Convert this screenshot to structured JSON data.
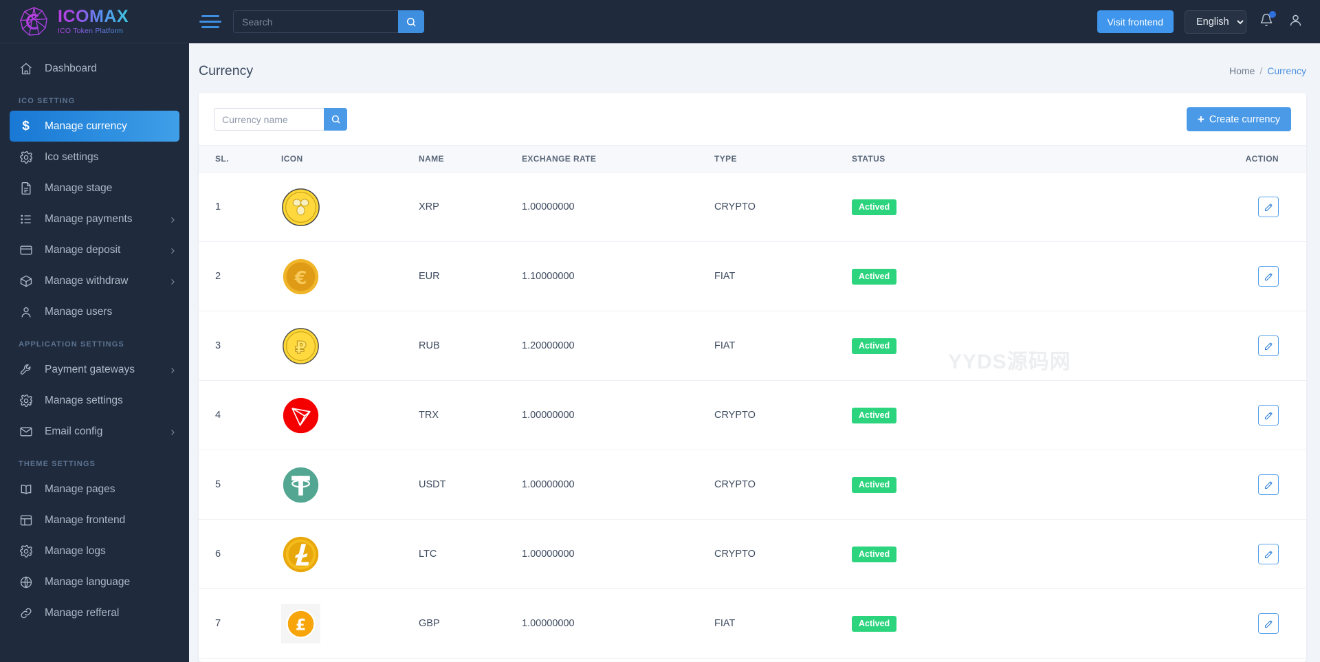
{
  "brand": {
    "title": "ICOMAX",
    "subtitle": "ICO Token Platform",
    "logo_icon": "icomax-gem-logo"
  },
  "topbar": {
    "menu_toggle_icon": "hamburger-icon",
    "search": {
      "placeholder": "Search",
      "value": "",
      "icon": "search-icon"
    },
    "visit_frontend_label": "Visit frontend",
    "language": {
      "selected": "English",
      "options": [
        "English"
      ]
    },
    "notification_icon": "bell-icon",
    "profile_icon": "user-icon"
  },
  "sidebar": {
    "top_items": [
      {
        "label": "Dashboard",
        "icon": "home-icon",
        "active": false,
        "has_arrow": false
      }
    ],
    "sections": [
      {
        "title": "ICO SETTING",
        "items": [
          {
            "label": "Manage currency",
            "icon": "dollar-icon",
            "active": true,
            "has_arrow": false
          },
          {
            "label": "Ico settings",
            "icon": "gear-icon",
            "active": false,
            "has_arrow": false
          },
          {
            "label": "Manage stage",
            "icon": "document-icon",
            "active": false,
            "has_arrow": false
          },
          {
            "label": "Manage payments",
            "icon": "list-icon",
            "active": false,
            "has_arrow": true
          },
          {
            "label": "Manage deposit",
            "icon": "credit-card-icon",
            "active": false,
            "has_arrow": true
          },
          {
            "label": "Manage withdraw",
            "icon": "box-icon",
            "active": false,
            "has_arrow": true
          },
          {
            "label": "Manage users",
            "icon": "user-icon",
            "active": false,
            "has_arrow": false
          }
        ]
      },
      {
        "title": "APPLICATION SETTINGS",
        "items": [
          {
            "label": "Payment gateways",
            "icon": "wrench-icon",
            "active": false,
            "has_arrow": true
          },
          {
            "label": "Manage settings",
            "icon": "gear-icon",
            "active": false,
            "has_arrow": false
          },
          {
            "label": "Email config",
            "icon": "envelope-icon",
            "active": false,
            "has_arrow": true
          }
        ]
      },
      {
        "title": "THEME SETTINGS",
        "items": [
          {
            "label": "Manage pages",
            "icon": "book-icon",
            "active": false,
            "has_arrow": false
          },
          {
            "label": "Manage frontend",
            "icon": "layout-icon",
            "active": false,
            "has_arrow": false
          },
          {
            "label": "Manage logs",
            "icon": "gear-icon",
            "active": false,
            "has_arrow": false
          },
          {
            "label": "Manage language",
            "icon": "globe-icon",
            "active": false,
            "has_arrow": false
          },
          {
            "label": "Manage refferal",
            "icon": "link-icon",
            "active": false,
            "has_arrow": false
          }
        ]
      }
    ]
  },
  "page": {
    "title": "Currency",
    "breadcrumb": {
      "home": "Home",
      "separator": "/",
      "current": "Currency"
    }
  },
  "toolbar": {
    "search": {
      "placeholder": "Currency name",
      "value": "",
      "icon": "search-icon"
    },
    "create_label": "Create currency",
    "create_icon": "plus-icon"
  },
  "table": {
    "columns": [
      "SL.",
      "ICON",
      "NAME",
      "EXCHANGE RATE",
      "TYPE",
      "STATUS",
      "ACTION"
    ],
    "rows": [
      {
        "sl": "1",
        "icon": "xrp-coin-icon",
        "name": "XRP",
        "rate": "1.00000000",
        "type": "CRYPTO",
        "status": "Actived",
        "action_icon": "edit-icon"
      },
      {
        "sl": "2",
        "icon": "eur-coin-icon",
        "name": "EUR",
        "rate": "1.10000000",
        "type": "FIAT",
        "status": "Actived",
        "action_icon": "edit-icon"
      },
      {
        "sl": "3",
        "icon": "rub-coin-icon",
        "name": "RUB",
        "rate": "1.20000000",
        "type": "FIAT",
        "status": "Actived",
        "action_icon": "edit-icon"
      },
      {
        "sl": "4",
        "icon": "trx-coin-icon",
        "name": "TRX",
        "rate": "1.00000000",
        "type": "CRYPTO",
        "status": "Actived",
        "action_icon": "edit-icon"
      },
      {
        "sl": "5",
        "icon": "usdt-coin-icon",
        "name": "USDT",
        "rate": "1.00000000",
        "type": "CRYPTO",
        "status": "Actived",
        "action_icon": "edit-icon"
      },
      {
        "sl": "6",
        "icon": "ltc-coin-icon",
        "name": "LTC",
        "rate": "1.00000000",
        "type": "CRYPTO",
        "status": "Actived",
        "action_icon": "edit-icon"
      },
      {
        "sl": "7",
        "icon": "gbp-coin-icon",
        "name": "GBP",
        "rate": "1.00000000",
        "type": "FIAT",
        "status": "Actived",
        "action_icon": "edit-icon"
      }
    ]
  },
  "watermark": {
    "text": "YYDS源码网"
  },
  "colors": {
    "sidebar_bg": "#1f2a3d",
    "accent_blue": "#4a9ae8",
    "active_nav": "#1878d4",
    "status_green": "#2bd47d",
    "page_bg": "#f1f4f9"
  }
}
